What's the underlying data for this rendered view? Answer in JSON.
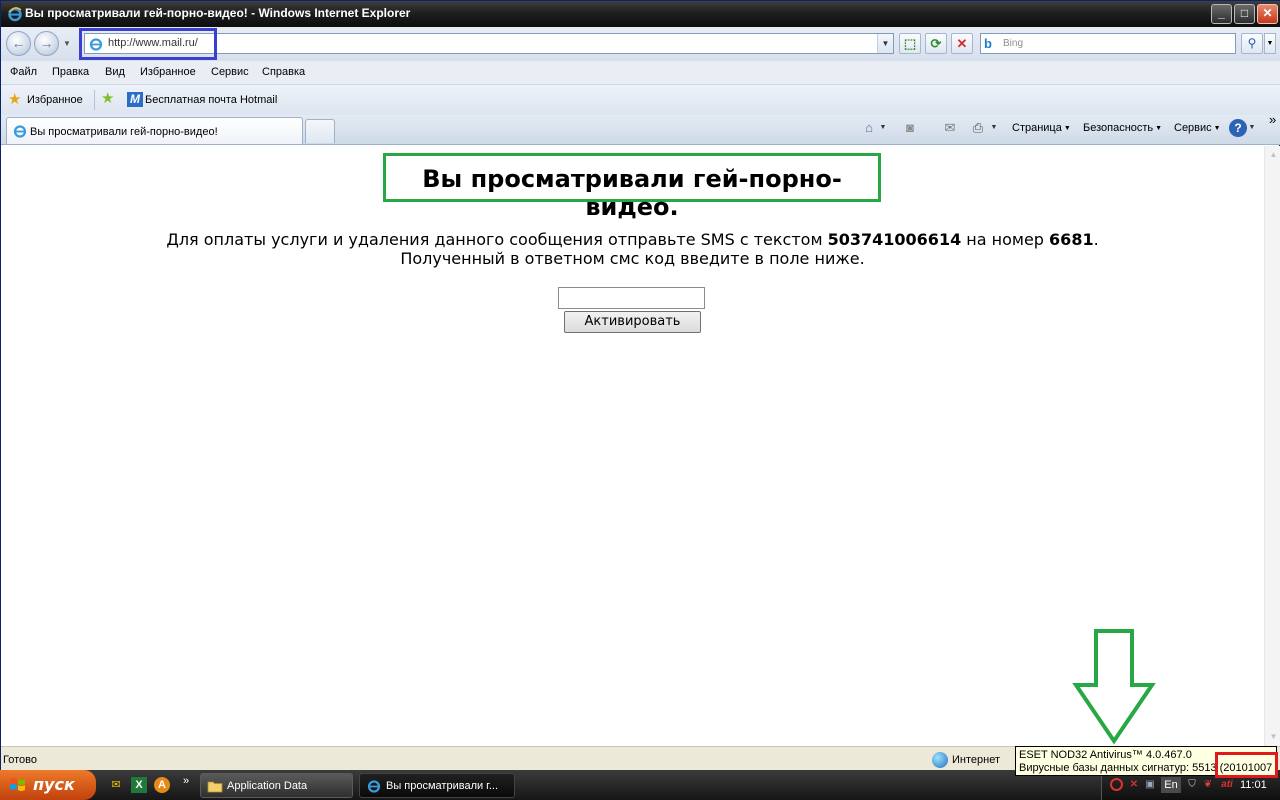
{
  "window": {
    "title": "Вы просматривали гей-порно-видео! - Windows Internet Explorer",
    "minimize_glyph": "_",
    "maximize_glyph": "□",
    "close_glyph": "✕"
  },
  "address_bar": {
    "url": "http://www.mail.ru/",
    "back_glyph": "←",
    "forward_glyph": "→",
    "compat_glyph": "⬚",
    "refresh_glyph": "⟳",
    "stop_glyph": "✕"
  },
  "search": {
    "placeholder": "Bing",
    "button_glyph": "⚲"
  },
  "menu": {
    "items": [
      "Файл",
      "Правка",
      "Вид",
      "Избранное",
      "Сервис",
      "Справка"
    ]
  },
  "favorites": {
    "label": "Избранное",
    "link": "Бесплатная почта Hotmail"
  },
  "tabs": [
    {
      "label": "Вы просматривали гей-порно-видео!"
    }
  ],
  "command_bar": {
    "page": "Страница",
    "safety": "Безопасность",
    "tools": "Сервис",
    "more": "»"
  },
  "page": {
    "heading": "Вы просматривали гей-порно-видео.",
    "line1_prefix": "Для оплаты услуги и удаления данного сообщения отправьте SMS с текстом ",
    "sms_code": "503741006614",
    "line1_middle": " на номер ",
    "sms_number": "6681",
    "line1_suffix": ".",
    "line2": "Полученный в ответном смс код введите в поле ниже.",
    "input_value": "",
    "button_label": "Активировать"
  },
  "status_bar": {
    "text": "Готово",
    "zone": "Интернет"
  },
  "tooltip": {
    "line1": "ESET NOD32 Antivirus™ 4.0.467.0",
    "line2": "Вирусные базы данных сигнатур: 5513 (20101007"
  },
  "taskbar": {
    "start_label": "пуск",
    "quicklaunch_more": "»",
    "tasks": [
      {
        "label": "Application Data"
      },
      {
        "label": "Вы просматривали г..."
      }
    ],
    "language": "En",
    "clock": "11:01"
  },
  "colors": {
    "highlight_green": "#27a844",
    "highlight_blue": "#3b3fcf",
    "highlight_red": "#e01a1a"
  }
}
